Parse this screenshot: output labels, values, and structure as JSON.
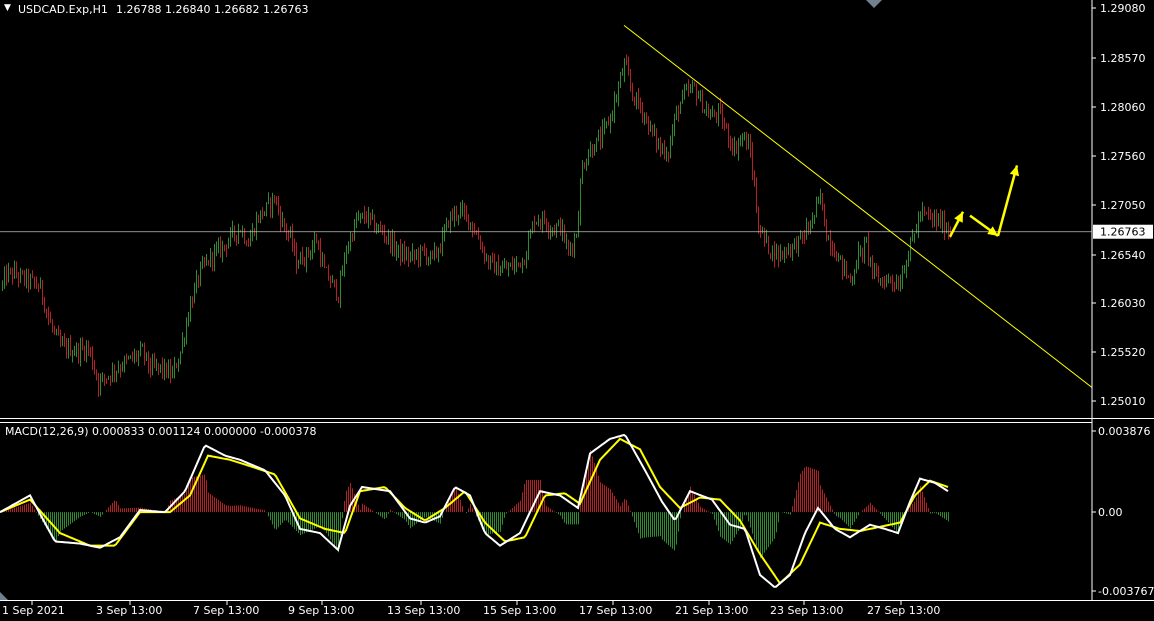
{
  "header": {
    "symbol_label": "USDCAD.Exp,H1",
    "ohlc_label": "1.26788 1.26840 1.26682 1.26763"
  },
  "indicator": {
    "label": "MACD(12,26,9) 0.000833 0.001124 0.000000 -0.000378"
  },
  "colors": {
    "background": "#000000",
    "axis": "#ffffff",
    "bull_bar": "#2e8b2e",
    "bear_bar": "#b22222",
    "trendline": "#ffff00",
    "macd_line": "#ffffff",
    "signal_line": "#ffff00",
    "arrow": "#ffff00"
  },
  "chart_data": [
    {
      "type": "candlestick",
      "symbol": "USDCAD.Exp",
      "timeframe": "H1",
      "y_ticks": [
        "1.29080",
        "1.28570",
        "1.28060",
        "1.27560",
        "1.27050",
        "1.26540",
        "1.26030",
        "1.25520",
        "1.25010"
      ],
      "y_tick_values": [
        1.2908,
        1.2857,
        1.2806,
        1.2756,
        1.2705,
        1.2654,
        1.2603,
        1.2552,
        1.2501
      ],
      "ylim": [
        1.2492,
        1.2913
      ],
      "current_price": 1.26763,
      "current_price_label": "1.26763",
      "x_ticks": [
        "1 Sep 2021",
        "3 Sep 13:00",
        "7 Sep 13:00",
        "9 Sep 13:00",
        "13 Sep 13:00",
        "15 Sep 13:00",
        "17 Sep 13:00",
        "21 Sep 13:00",
        "23 Sep 13:00",
        "27 Sep 13:00"
      ],
      "close_path": [
        [
          0,
          1.2615
        ],
        [
          6,
          1.2632
        ],
        [
          14,
          1.2633
        ],
        [
          22,
          1.2628
        ],
        [
          30,
          1.2625
        ],
        [
          40,
          1.2618
        ],
        [
          50,
          1.258
        ],
        [
          60,
          1.2558
        ],
        [
          75,
          1.2553
        ],
        [
          88,
          1.2556
        ],
        [
          98,
          1.252
        ],
        [
          108,
          1.2528
        ],
        [
          120,
          1.2538
        ],
        [
          132,
          1.2545
        ],
        [
          142,
          1.2552
        ],
        [
          150,
          1.2535
        ],
        [
          160,
          1.2535
        ],
        [
          172,
          1.2528
        ],
        [
          180,
          1.2552
        ],
        [
          190,
          1.2602
        ],
        [
          200,
          1.2635
        ],
        [
          212,
          1.2652
        ],
        [
          222,
          1.266
        ],
        [
          232,
          1.2673
        ],
        [
          240,
          1.268
        ],
        [
          248,
          1.2665
        ],
        [
          258,
          1.2692
        ],
        [
          266,
          1.27
        ],
        [
          274,
          1.2712
        ],
        [
          282,
          1.2685
        ],
        [
          290,
          1.267
        ],
        [
          296,
          1.2645
        ],
        [
          306,
          1.2652
        ],
        [
          316,
          1.2668
        ],
        [
          324,
          1.2635
        ],
        [
          332,
          1.2622
        ],
        [
          338,
          1.2612
        ],
        [
          346,
          1.2658
        ],
        [
          356,
          1.2688
        ],
        [
          366,
          1.2692
        ],
        [
          376,
          1.268
        ],
        [
          384,
          1.2675
        ],
        [
          394,
          1.266
        ],
        [
          402,
          1.2652
        ],
        [
          412,
          1.265
        ],
        [
          422,
          1.2655
        ],
        [
          432,
          1.2648
        ],
        [
          440,
          1.2662
        ],
        [
          448,
          1.2688
        ],
        [
          458,
          1.2698
        ],
        [
          468,
          1.269
        ],
        [
          478,
          1.267
        ],
        [
          486,
          1.2648
        ],
        [
          496,
          1.2638
        ],
        [
          506,
          1.2638
        ],
        [
          516,
          1.2642
        ],
        [
          524,
          1.265
        ],
        [
          534,
          1.269
        ],
        [
          544,
          1.2688
        ],
        [
          552,
          1.268
        ],
        [
          560,
          1.2682
        ],
        [
          568,
          1.2655
        ],
        [
          576,
          1.2675
        ],
        [
          582,
          1.2745
        ],
        [
          590,
          1.2762
        ],
        [
          600,
          1.2772
        ],
        [
          610,
          1.2795
        ],
        [
          618,
          1.2825
        ],
        [
          624,
          1.285
        ],
        [
          632,
          1.2818
        ],
        [
          642,
          1.2802
        ],
        [
          650,
          1.2782
        ],
        [
          660,
          1.2762
        ],
        [
          668,
          1.276
        ],
        [
          676,
          1.28
        ],
        [
          684,
          1.2818
        ],
        [
          694,
          1.2825
        ],
        [
          702,
          1.2808
        ],
        [
          710,
          1.2795
        ],
        [
          718,
          1.28
        ],
        [
          726,
          1.278
        ],
        [
          734,
          1.2762
        ],
        [
          742,
          1.2775
        ],
        [
          750,
          1.276
        ],
        [
          758,
          1.2682
        ],
        [
          768,
          1.266
        ],
        [
          778,
          1.2652
        ],
        [
          786,
          1.2658
        ],
        [
          794,
          1.2662
        ],
        [
          802,
          1.267
        ],
        [
          812,
          1.2688
        ],
        [
          820,
          1.2712
        ],
        [
          826,
          1.2675
        ],
        [
          834,
          1.2658
        ],
        [
          842,
          1.264
        ],
        [
          850,
          1.2625
        ],
        [
          858,
          1.2652
        ],
        [
          866,
          1.2662
        ],
        [
          874,
          1.263
        ],
        [
          882,
          1.2625
        ],
        [
          890,
          1.2628
        ],
        [
          898,
          1.2622
        ],
        [
          906,
          1.2648
        ],
        [
          914,
          1.2675
        ],
        [
          920,
          1.2695
        ],
        [
          926,
          1.2692
        ],
        [
          934,
          1.2688
        ],
        [
          942,
          1.2685
        ],
        [
          950,
          1.2676
        ]
      ],
      "bar_x_range": [
        2,
        950
      ],
      "trendline": {
        "from": {
          "x": 624,
          "price": 1.289
        },
        "to": {
          "x": 1092,
          "price": 1.2515
        }
      },
      "forecast_arrows": [
        {
          "from": {
            "x": 950,
            "price": 1.2671
          },
          "to": {
            "x": 963,
            "price": 1.2697
          }
        },
        {
          "from": {
            "x": 970,
            "price": 1.2693
          },
          "to": {
            "x": 998,
            "price": 1.2672
          }
        },
        {
          "from": {
            "x": 998,
            "price": 1.2672
          },
          "to": {
            "x": 1017,
            "price": 1.2745
          }
        }
      ]
    },
    {
      "type": "macd",
      "params": [
        12,
        26,
        9
      ],
      "values": {
        "macd": 0.000833,
        "signal": 0.001124,
        "third": 0.0,
        "histogram": -0.000378
      },
      "y_ticks": [
        "0.003876",
        "0.00",
        "-0.003767"
      ],
      "y_tick_values": [
        0.003876,
        0.0,
        -0.003767
      ],
      "ylim": [
        -0.0042,
        0.0042
      ],
      "macd_path": [
        [
          0,
          0
        ],
        [
          30,
          0.0008
        ],
        [
          55,
          -0.0014
        ],
        [
          80,
          -0.0015
        ],
        [
          100,
          -0.0017
        ],
        [
          120,
          -0.0012
        ],
        [
          140,
          0.0001
        ],
        [
          165,
          0.0
        ],
        [
          185,
          0.001
        ],
        [
          205,
          0.0032
        ],
        [
          225,
          0.0027
        ],
        [
          240,
          0.0025
        ],
        [
          265,
          0.002
        ],
        [
          285,
          0.0008
        ],
        [
          300,
          -0.0008
        ],
        [
          320,
          -0.001
        ],
        [
          338,
          -0.0018
        ],
        [
          350,
          0.0003
        ],
        [
          362,
          0.0012
        ],
        [
          390,
          0.001
        ],
        [
          410,
          -0.0003
        ],
        [
          425,
          -0.0005
        ],
        [
          440,
          -0.0002
        ],
        [
          455,
          0.0012
        ],
        [
          470,
          0.0008
        ],
        [
          485,
          -0.001
        ],
        [
          500,
          -0.0016
        ],
        [
          520,
          -0.001
        ],
        [
          540,
          0.001
        ],
        [
          560,
          0.0008
        ],
        [
          578,
          0.0002
        ],
        [
          590,
          0.0028
        ],
        [
          610,
          0.0035
        ],
        [
          625,
          0.0037
        ],
        [
          645,
          0.002
        ],
        [
          662,
          0.0005
        ],
        [
          675,
          -0.0004
        ],
        [
          690,
          0.001
        ],
        [
          712,
          0.0006
        ],
        [
          730,
          -0.0006
        ],
        [
          745,
          -0.0008
        ],
        [
          760,
          -0.003
        ],
        [
          775,
          -0.0036
        ],
        [
          790,
          -0.003
        ],
        [
          805,
          -0.001
        ],
        [
          818,
          0.0002
        ],
        [
          835,
          -0.0008
        ],
        [
          850,
          -0.0012
        ],
        [
          870,
          -0.0006
        ],
        [
          885,
          -0.0008
        ],
        [
          898,
          -0.001
        ],
        [
          910,
          0.0005
        ],
        [
          920,
          0.0016
        ],
        [
          935,
          0.0014
        ],
        [
          948,
          0.001
        ]
      ],
      "signal_path": [
        [
          0,
          0
        ],
        [
          30,
          0.0006
        ],
        [
          60,
          -0.001
        ],
        [
          90,
          -0.0016
        ],
        [
          115,
          -0.0016
        ],
        [
          140,
          0.0
        ],
        [
          170,
          0.0
        ],
        [
          190,
          0.0008
        ],
        [
          208,
          0.0027
        ],
        [
          230,
          0.0025
        ],
        [
          250,
          0.0022
        ],
        [
          275,
          0.0018
        ],
        [
          300,
          -0.0003
        ],
        [
          325,
          -0.0008
        ],
        [
          345,
          -0.001
        ],
        [
          360,
          0.001
        ],
        [
          385,
          0.0012
        ],
        [
          405,
          0.0002
        ],
        [
          425,
          -0.0004
        ],
        [
          445,
          0.0002
        ],
        [
          465,
          0.001
        ],
        [
          485,
          -0.0005
        ],
        [
          505,
          -0.0014
        ],
        [
          525,
          -0.0012
        ],
        [
          545,
          0.0008
        ],
        [
          565,
          0.0009
        ],
        [
          580,
          0.0004
        ],
        [
          600,
          0.0025
        ],
        [
          620,
          0.0035
        ],
        [
          640,
          0.003
        ],
        [
          660,
          0.0012
        ],
        [
          680,
          0.0002
        ],
        [
          700,
          0.0007
        ],
        [
          720,
          0.0006
        ],
        [
          740,
          -0.0004
        ],
        [
          760,
          -0.002
        ],
        [
          780,
          -0.0034
        ],
        [
          800,
          -0.0025
        ],
        [
          820,
          -0.0005
        ],
        [
          840,
          -0.0008
        ],
        [
          860,
          -0.0009
        ],
        [
          880,
          -0.0007
        ],
        [
          900,
          -0.0005
        ],
        [
          915,
          0.0008
        ],
        [
          930,
          0.0015
        ],
        [
          948,
          0.0012
        ]
      ]
    }
  ]
}
